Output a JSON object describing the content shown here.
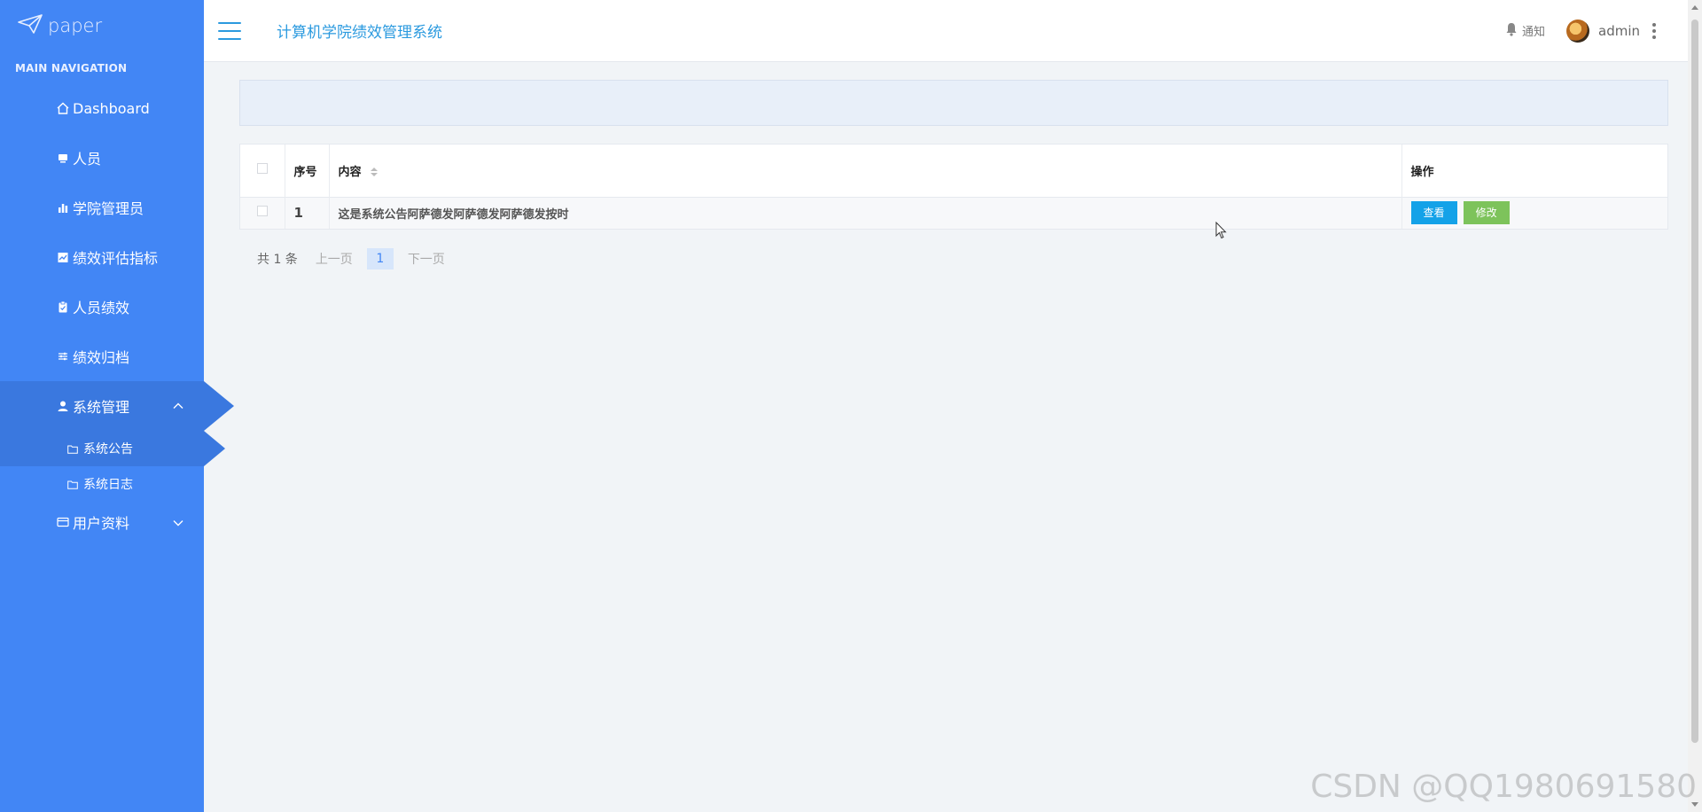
{
  "brand": {
    "name": "paper"
  },
  "sidebar": {
    "header": "MAIN NAVIGATION",
    "items": [
      {
        "label": "Dashboard",
        "icon": "home-icon"
      },
      {
        "label": "人员",
        "icon": "monitor-icon"
      },
      {
        "label": "学院管理员",
        "icon": "bar-chart-icon"
      },
      {
        "label": "绩效评估指标",
        "icon": "line-chart-icon"
      },
      {
        "label": "人员绩效",
        "icon": "clipboard-icon"
      },
      {
        "label": "绩效归档",
        "icon": "sliders-icon"
      },
      {
        "label": "系统管理",
        "icon": "user-icon",
        "expanded": true,
        "children": [
          {
            "label": "系统公告",
            "icon": "folder-icon",
            "active": true
          },
          {
            "label": "系统日志",
            "icon": "folder-icon"
          }
        ]
      },
      {
        "label": "用户资料",
        "icon": "card-icon",
        "expanded": false
      }
    ]
  },
  "header": {
    "title": "计算机学院绩效管理系统",
    "notify_label": "通知",
    "user_name": "admin"
  },
  "table": {
    "columns": {
      "no": "序号",
      "content": "内容",
      "action": "操作"
    },
    "rows": [
      {
        "no": "1",
        "content": "这是系统公告阿萨德发阿萨德发阿萨德发按时"
      }
    ],
    "view_label": "查看",
    "edit_label": "修改"
  },
  "pager": {
    "total": "共 1 条",
    "prev": "上一页",
    "current": "1",
    "next": "下一页"
  },
  "watermark": "CSDN @QQ1980691580",
  "colors": {
    "sidebar": "#4286f5",
    "sidebar_active": "#3a78df",
    "accent": "#2b9adf",
    "view_button": "#14a2e8",
    "edit_button": "#7dc35b"
  }
}
